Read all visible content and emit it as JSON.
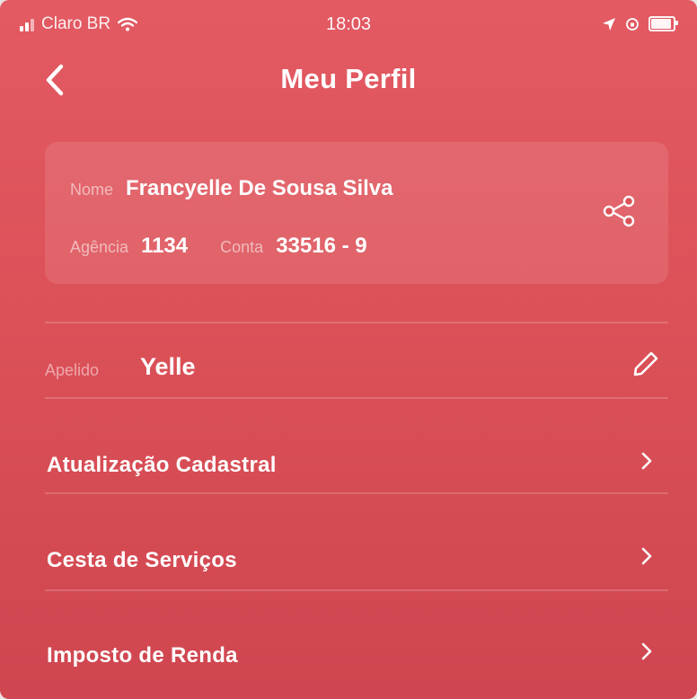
{
  "status_bar": {
    "carrier": "Claro BR",
    "time": "18:03"
  },
  "header": {
    "title": "Meu Perfil"
  },
  "profile": {
    "name_label": "Nome",
    "name_value": "Francyelle De Sousa Silva",
    "agency_label": "Agência",
    "agency_value": "1134",
    "account_label": "Conta",
    "account_value": "33516 - 9"
  },
  "nickname": {
    "label": "Apelido",
    "value": "Yelle"
  },
  "menu": {
    "items": [
      {
        "label": "Atualização Cadastral"
      },
      {
        "label": "Cesta de Serviços"
      },
      {
        "label": "Imposto de Renda"
      }
    ]
  },
  "icons": {
    "back": "chevron-left-icon",
    "share": "share-icon",
    "edit": "pencil-icon",
    "row_arrow": "chevron-right-icon"
  },
  "colors": {
    "background": "#dc5158",
    "text": "#ffffff"
  }
}
